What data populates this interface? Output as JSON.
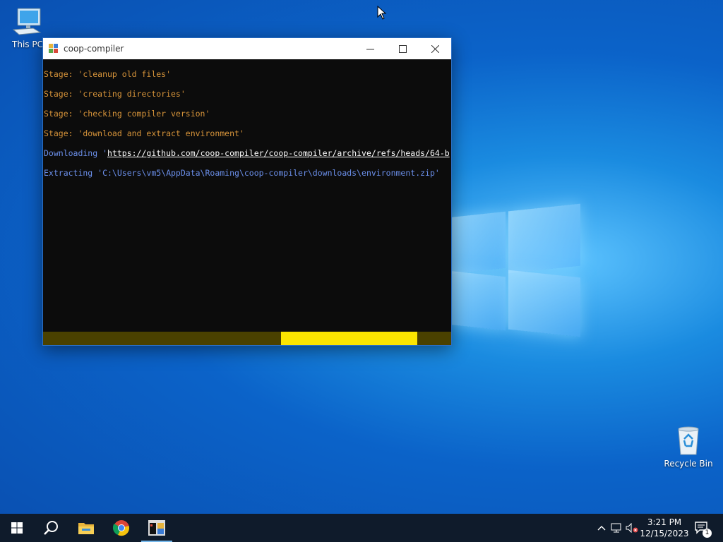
{
  "desktop": {
    "icons": [
      {
        "label": "This PC",
        "icon": "computer-icon"
      },
      {
        "label": "Recycle Bin",
        "icon": "recycle-bin-icon"
      }
    ]
  },
  "window": {
    "title": "coop-compiler",
    "icon": "app-icon",
    "controls": {
      "minimize": "minimize-icon",
      "maximize": "maximize-icon",
      "close": "close-icon"
    }
  },
  "console": {
    "lines": [
      {
        "text": "Stage: 'cleanup old files'"
      },
      {
        "text": "Stage: 'creating directories'"
      },
      {
        "text": "Stage: 'checking compiler version'"
      },
      {
        "text": "Stage: 'download and extract environment'"
      },
      {
        "prefix": "Downloading '",
        "link": "https://github.com/coop-compiler/coop-compiler/archive/refs/heads/64-b"
      },
      {
        "text": "Extracting 'C:\\Users\\vm5\\AppData\\Roaming\\coop-compiler\\downloads\\environment.zip'"
      }
    ],
    "colors": {
      "stage": "#d7943a",
      "info": "#6b8fea",
      "link": "#ffffff",
      "background": "#0c0c0c"
    }
  },
  "progress": {
    "segment_start": 0.583,
    "segment_end": 0.917,
    "track_color": "#4a4100",
    "fill_color": "#fbe500"
  },
  "taskbar": {
    "items": [
      {
        "icon": "windows-start-icon"
      },
      {
        "icon": "search-icon"
      },
      {
        "icon": "file-explorer-icon"
      },
      {
        "icon": "chrome-icon"
      },
      {
        "icon": "console-app-icon"
      }
    ],
    "tray": {
      "icons": [
        "chevron-up-icon",
        "network-icon",
        "volume-muted-icon",
        "notification-icon"
      ],
      "time": "3:21 PM",
      "date": "12/15/2023",
      "notification_count": "1"
    }
  }
}
